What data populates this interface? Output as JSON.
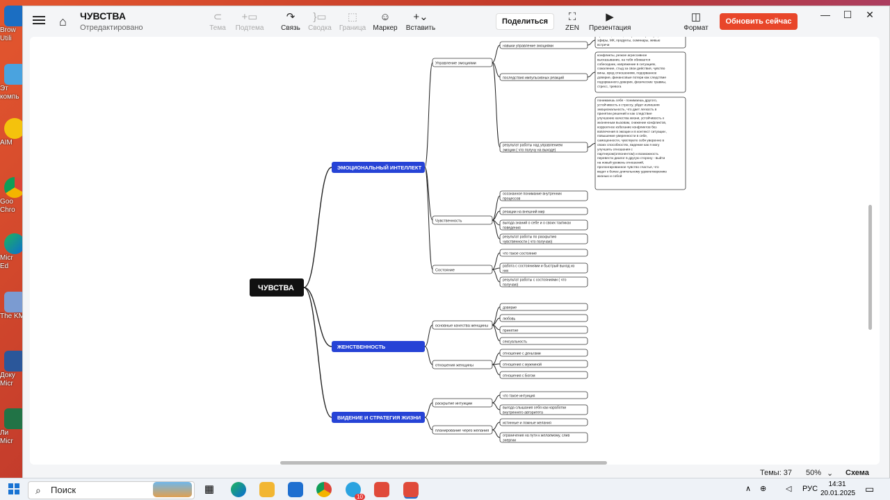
{
  "desktop": {
    "icons": [
      {
        "label": "Brow",
        "label2": "Utili"
      },
      {
        "label": "Эт",
        "label2": "компь"
      },
      {
        "label": "AIM"
      },
      {
        "label": "Goo",
        "label2": "Chro"
      },
      {
        "label": "Micr",
        "label2": "Ed"
      },
      {
        "label": "The KM"
      },
      {
        "label": "Доку",
        "label2": "Micr"
      },
      {
        "label": "Ли",
        "label2": "Micr"
      }
    ]
  },
  "app": {
    "title": "ЧУВСТВА",
    "status": "Отредактировано",
    "tools": [
      {
        "label": "Тема",
        "icon": "topic-icon",
        "glyph": "⊂",
        "enabled": false
      },
      {
        "label": "Подтема",
        "icon": "subtopic-icon",
        "glyph": "+▭",
        "enabled": false
      },
      {
        "label": "Связь",
        "icon": "relationship-icon",
        "glyph": "↷",
        "enabled": true
      },
      {
        "label": "Сводка",
        "icon": "summary-icon",
        "glyph": "}▭",
        "enabled": false
      },
      {
        "label": "Граница",
        "icon": "boundary-icon",
        "glyph": "⬚",
        "enabled": false
      },
      {
        "label": "Маркер",
        "icon": "smiley-icon",
        "glyph": "☺",
        "enabled": true
      },
      {
        "label": "Вставить",
        "icon": "plus-icon",
        "glyph": "+⌄",
        "enabled": true
      }
    ],
    "share_label": "Поделиться",
    "zen_label": "ZEN",
    "presentation_label": "Презентация",
    "format_label": "Формат",
    "update_label": "Обновить сейчас",
    "accent_color": "#e8462a",
    "status_bar": {
      "topics": "Темы: 37",
      "zoom": "50%",
      "zoom_caret": "⌄",
      "view": "Схема"
    }
  },
  "mindmap": {
    "root": "ЧУВСТВА",
    "branches": [
      {
        "label": "ЭМОЦИОНАЛЬНЫЙ ИНТЕЛЛЕКТ",
        "subs": [
          {
            "label": "Управление эмоциями",
            "items": [
              {
                "label": "навыки управление эмоциями",
                "note": [
                  "практики, статьи, конкретные примеры,",
                  "эфиры, МК, продукты, семинары, живые",
                  "встречи"
                ]
              },
              {
                "label": "последствия импульсивных реакций",
                "note": [
                  "конфликты, резкое агрессивное",
                  "высказывание, на тебя обижается",
                  "собеседник, напряжение в ситуациях,",
                  "сожаление, стыд за свои действия, чувство",
                  "вины, вред отношениям, подорванное",
                  "доверие, финансовые потери как следствие",
                  "подорванного доверия, физические травмы,",
                  "стресс, тревога"
                ]
              },
              {
                "label": [
                  "результат работы над управлением",
                  "эмоции ( что получу на выходе)"
                ],
                "note": [
                  "понимаешь себя - понимаешь другого,",
                  "устойчивость к стрессу, уйдет излишняя",
                  "эмоциональность, что дает легкость в",
                  "принятии решений и как следствие",
                  "улучшение качества жизни, устойчивость к",
                  "жизненным вызовам, снижение конфликтов,",
                  "корректное избегание конфликтов без",
                  "вовлечения в эмоции и в контекст ситуации ,",
                  "повышение уверенности в себе,",
                  "самоценности, чувствуете себя уверенно в",
                  "своих способностях, видение как я могу",
                  "улучшить отношения с",
                  "партнером(оппонентом) и возможность",
                  "перевести диалог в другую сторону - выйти",
                  "на новый уровень отношений,",
                  "пролонгированное чувство счастья, что",
                  "ведет к более длительному удовлетворению",
                  "жизнью и собой"
                ]
              }
            ]
          },
          {
            "label": "Чувственность",
            "items": [
              {
                "label": [
                  "осознанное понимание внутренних",
                  "процессов"
                ]
              },
              {
                "label": "реакции на внешний мир"
              },
              {
                "label": [
                  "выгода знаний о себе и о своих тактиках",
                  "поведения"
                ]
              },
              {
                "label": [
                  "результат работы по раскрытию",
                  "чувственности ( что получаю)"
                ]
              }
            ]
          },
          {
            "label": "Состояние",
            "items": [
              {
                "label": "что такое состояние"
              },
              {
                "label": [
                  "работа с состояниями и быстрый выход из",
                  "них"
                ]
              },
              {
                "label": [
                  "результат работы с состояниями ( что",
                  "получаю)"
                ]
              }
            ]
          }
        ]
      },
      {
        "label": "ЖЕНСТВЕННОСТЬ",
        "subs": [
          {
            "label": "основные качества женщины",
            "items": [
              {
                "label": "доверие"
              },
              {
                "label": "любовь"
              },
              {
                "label": "принятие"
              },
              {
                "label": "сексуальность"
              }
            ]
          },
          {
            "label": "отношения женщины",
            "items": [
              {
                "label": "отношение с деньгами"
              },
              {
                "label": "отношения с мужчиной"
              },
              {
                "label": "отношения с Богом"
              }
            ]
          }
        ]
      },
      {
        "label": "ВИДЕНИЕ И СТРАТЕГИЯ ЖИЗНИ",
        "subs": [
          {
            "label": "раскрытие интуиции",
            "items": [
              {
                "label": "что такое интуиция"
              },
              {
                "label": [
                  "выгода слышания себя как наработки",
                  "внутреннего авторитета"
                ]
              }
            ]
          },
          {
            "label": "планирование через желания",
            "items": [
              {
                "label": "истинные и ложные желания"
              },
              {
                "label": [
                  "ограничения на пути к желаемому, слив",
                  "энергии"
                ]
              }
            ]
          }
        ]
      }
    ],
    "colors": {
      "root_bg": "#111111",
      "branch_bg": "#2643d6",
      "line": "#222222",
      "leaf_border": "#333333"
    }
  },
  "taskbar": {
    "search_placeholder": "Поиск",
    "lang": "РУС",
    "time": "14:31",
    "date": "20.01.2025",
    "badge": "10"
  }
}
